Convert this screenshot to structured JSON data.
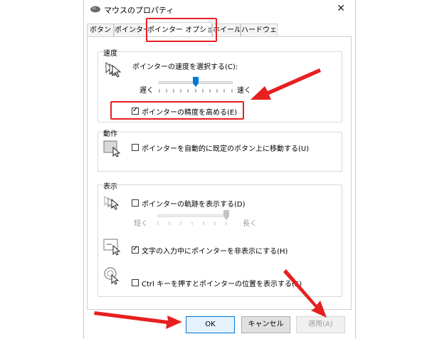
{
  "window": {
    "title": "マウスのプロパティ",
    "close_glyph": "✕"
  },
  "tabs": [
    {
      "label": "ボタン",
      "active": false
    },
    {
      "label": "ポインター",
      "active": false
    },
    {
      "label": "ポインター オプション",
      "active": true
    },
    {
      "label": "ホイール",
      "active": false
    },
    {
      "label": "ハードウェア",
      "active": false
    }
  ],
  "speed": {
    "group_label": "速度",
    "select_label": "ポインターの速度を選択する(C):",
    "slow_label": "遅く",
    "fast_label": "速く",
    "slider_value_fraction": 0.5,
    "precision_label": "ポインターの精度を高める(E)",
    "precision_checked": true
  },
  "motion": {
    "group_label": "動作",
    "snap_label": "ポインターを自動的に既定のボタン上に移動する(U)",
    "snap_checked": false
  },
  "visibility": {
    "group_label": "表示",
    "trails_label": "ポインターの軌跡を表示する(D)",
    "trails_checked": false,
    "short_label": "短く",
    "long_label": "長く",
    "trail_slider_fraction": 1.0,
    "hide_label": "文字の入力中にポインターを非表示にする(H)",
    "hide_checked": true,
    "ctrl_label": "Ctrl キーを押すとポインターの位置を表示する(S)",
    "ctrl_checked": false
  },
  "buttons": {
    "ok": "OK",
    "cancel": "キャンセル",
    "apply": "適用(A)"
  },
  "colors": {
    "highlight": "#e62020",
    "accent": "#0078d7"
  },
  "icons": [
    "mouse-icon",
    "pointer-speed-icon",
    "snap-to-icon",
    "pointer-trails-icon",
    "hide-pointer-icon",
    "show-location-icon"
  ]
}
